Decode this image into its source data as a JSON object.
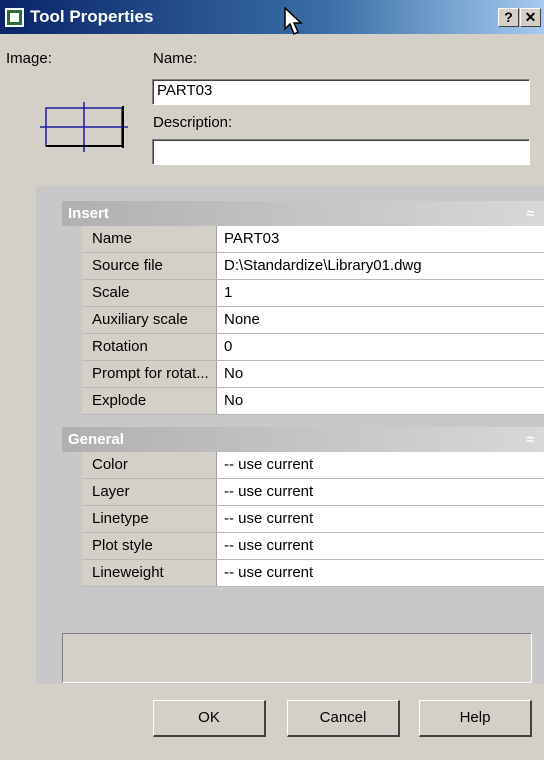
{
  "window": {
    "title": "Tool Properties",
    "help_glyph": "?",
    "close_glyph": "✕"
  },
  "top": {
    "image_label": "Image:",
    "name_label": "Name:",
    "name_value": "PART03",
    "description_label": "Description:",
    "description_value": ""
  },
  "sections": {
    "insert": {
      "title": "Insert",
      "rows": [
        {
          "key": "Name",
          "value": "PART03"
        },
        {
          "key": "Source file",
          "value": "D:\\Standardize\\Library01.dwg"
        },
        {
          "key": "Scale",
          "value": "1"
        },
        {
          "key": "Auxiliary scale",
          "value": "None"
        },
        {
          "key": "Rotation",
          "value": "0"
        },
        {
          "key": "Prompt for rotat...",
          "value": "No"
        },
        {
          "key": "Explode",
          "value": "No"
        }
      ]
    },
    "general": {
      "title": "General",
      "rows": [
        {
          "key": "Color",
          "value": "-- use current"
        },
        {
          "key": "Layer",
          "value": "-- use current"
        },
        {
          "key": "Linetype",
          "value": "-- use current"
        },
        {
          "key": "Plot style",
          "value": "-- use current"
        },
        {
          "key": "Lineweight",
          "value": "-- use current"
        }
      ]
    },
    "collapse_glyph": "≈"
  },
  "buttons": {
    "ok": "OK",
    "cancel": "Cancel",
    "help": "Help"
  },
  "colors": {
    "title_bar": "#0a246a",
    "dialog_bg": "#d4d0c8",
    "preview_line": "#1a1aa0"
  }
}
